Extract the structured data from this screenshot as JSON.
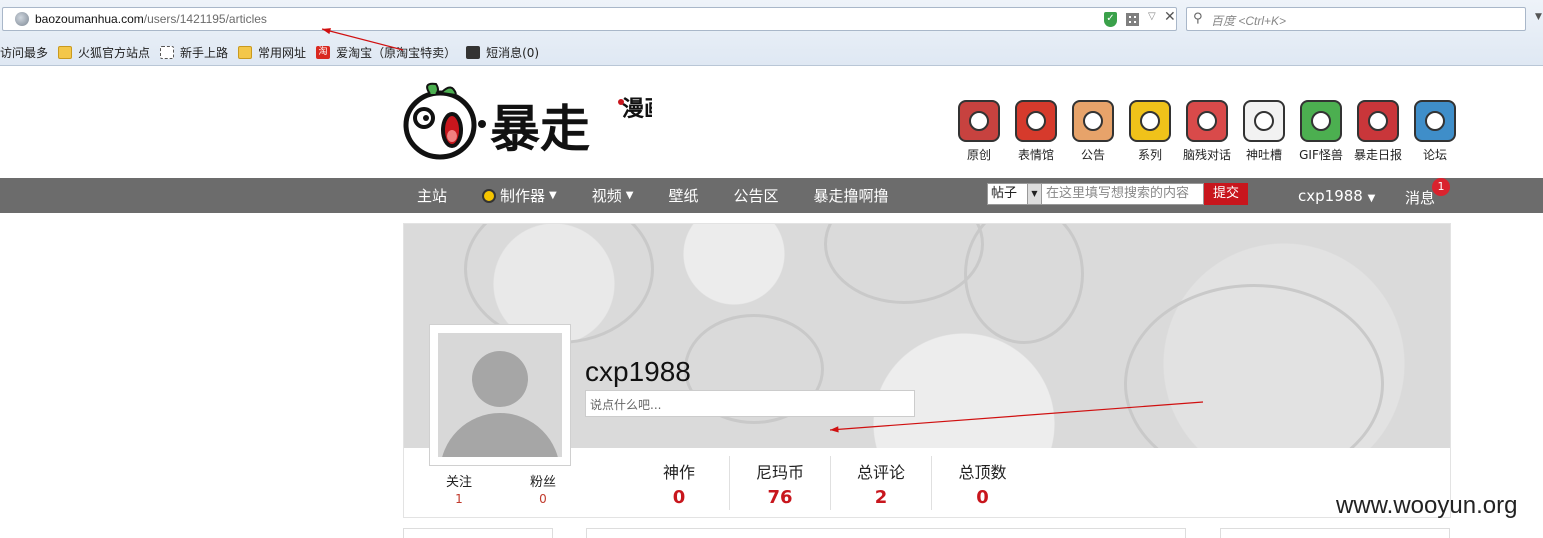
{
  "browser": {
    "url_host": "baozoumanhua.com",
    "url_path": "/users/1421195/articles",
    "search_placeholder": "百度 <Ctrl+K>",
    "bookmarks": [
      {
        "label": "访问最多",
        "icon": "none"
      },
      {
        "label": "火狐官方站点",
        "icon": "folder"
      },
      {
        "label": "新手上路",
        "icon": "dashed"
      },
      {
        "label": "常用网址",
        "icon": "folder"
      },
      {
        "label": "爱淘宝（原淘宝特卖）",
        "icon": "taobao"
      },
      {
        "label": "短消息(0)",
        "icon": "message"
      }
    ]
  },
  "site": {
    "logo_text": "暴走",
    "logo_sub": "漫画",
    "top_nav": [
      {
        "label": "原创",
        "color": "#c7423f"
      },
      {
        "label": "表情馆",
        "color": "#d63a2c"
      },
      {
        "label": "公告",
        "color": "#e7a36a"
      },
      {
        "label": "系列",
        "color": "#f0c21a"
      },
      {
        "label": "脑残对话",
        "color": "#d94a4a"
      },
      {
        "label": "神吐槽",
        "color": "#f2f2f2"
      },
      {
        "label": "GIF怪兽",
        "color": "#4caf50"
      },
      {
        "label": "暴走日报",
        "color": "#c9363a"
      },
      {
        "label": "论坛",
        "color": "#3f8ec9"
      }
    ],
    "nav": {
      "items": [
        {
          "label": "主站",
          "dropdown": false
        },
        {
          "label": "制作器",
          "dropdown": true
        },
        {
          "label": "视频",
          "dropdown": true
        },
        {
          "label": "壁纸",
          "dropdown": false
        },
        {
          "label": "公告区",
          "dropdown": false
        },
        {
          "label": "暴走撸啊撸",
          "dropdown": false
        }
      ],
      "search_scope": "帖子",
      "search_placeholder": "在这里填写想搜索的内容",
      "search_button": "提交",
      "user": "cxp1988",
      "messages": "消息",
      "message_count": "1"
    }
  },
  "profile": {
    "username": "cxp1988",
    "status_placeholder": "说点什么吧...",
    "follow": [
      {
        "label": "关注",
        "value": "1"
      },
      {
        "label": "粉丝",
        "value": "0"
      }
    ],
    "stats": [
      {
        "label": "神作",
        "value": "0"
      },
      {
        "label": "尼玛币",
        "value": "76"
      },
      {
        "label": "总评论",
        "value": "2"
      },
      {
        "label": "总顶数",
        "value": "0"
      }
    ]
  },
  "watermark": "www.wooyun.org",
  "annotation_color": "#d01010"
}
